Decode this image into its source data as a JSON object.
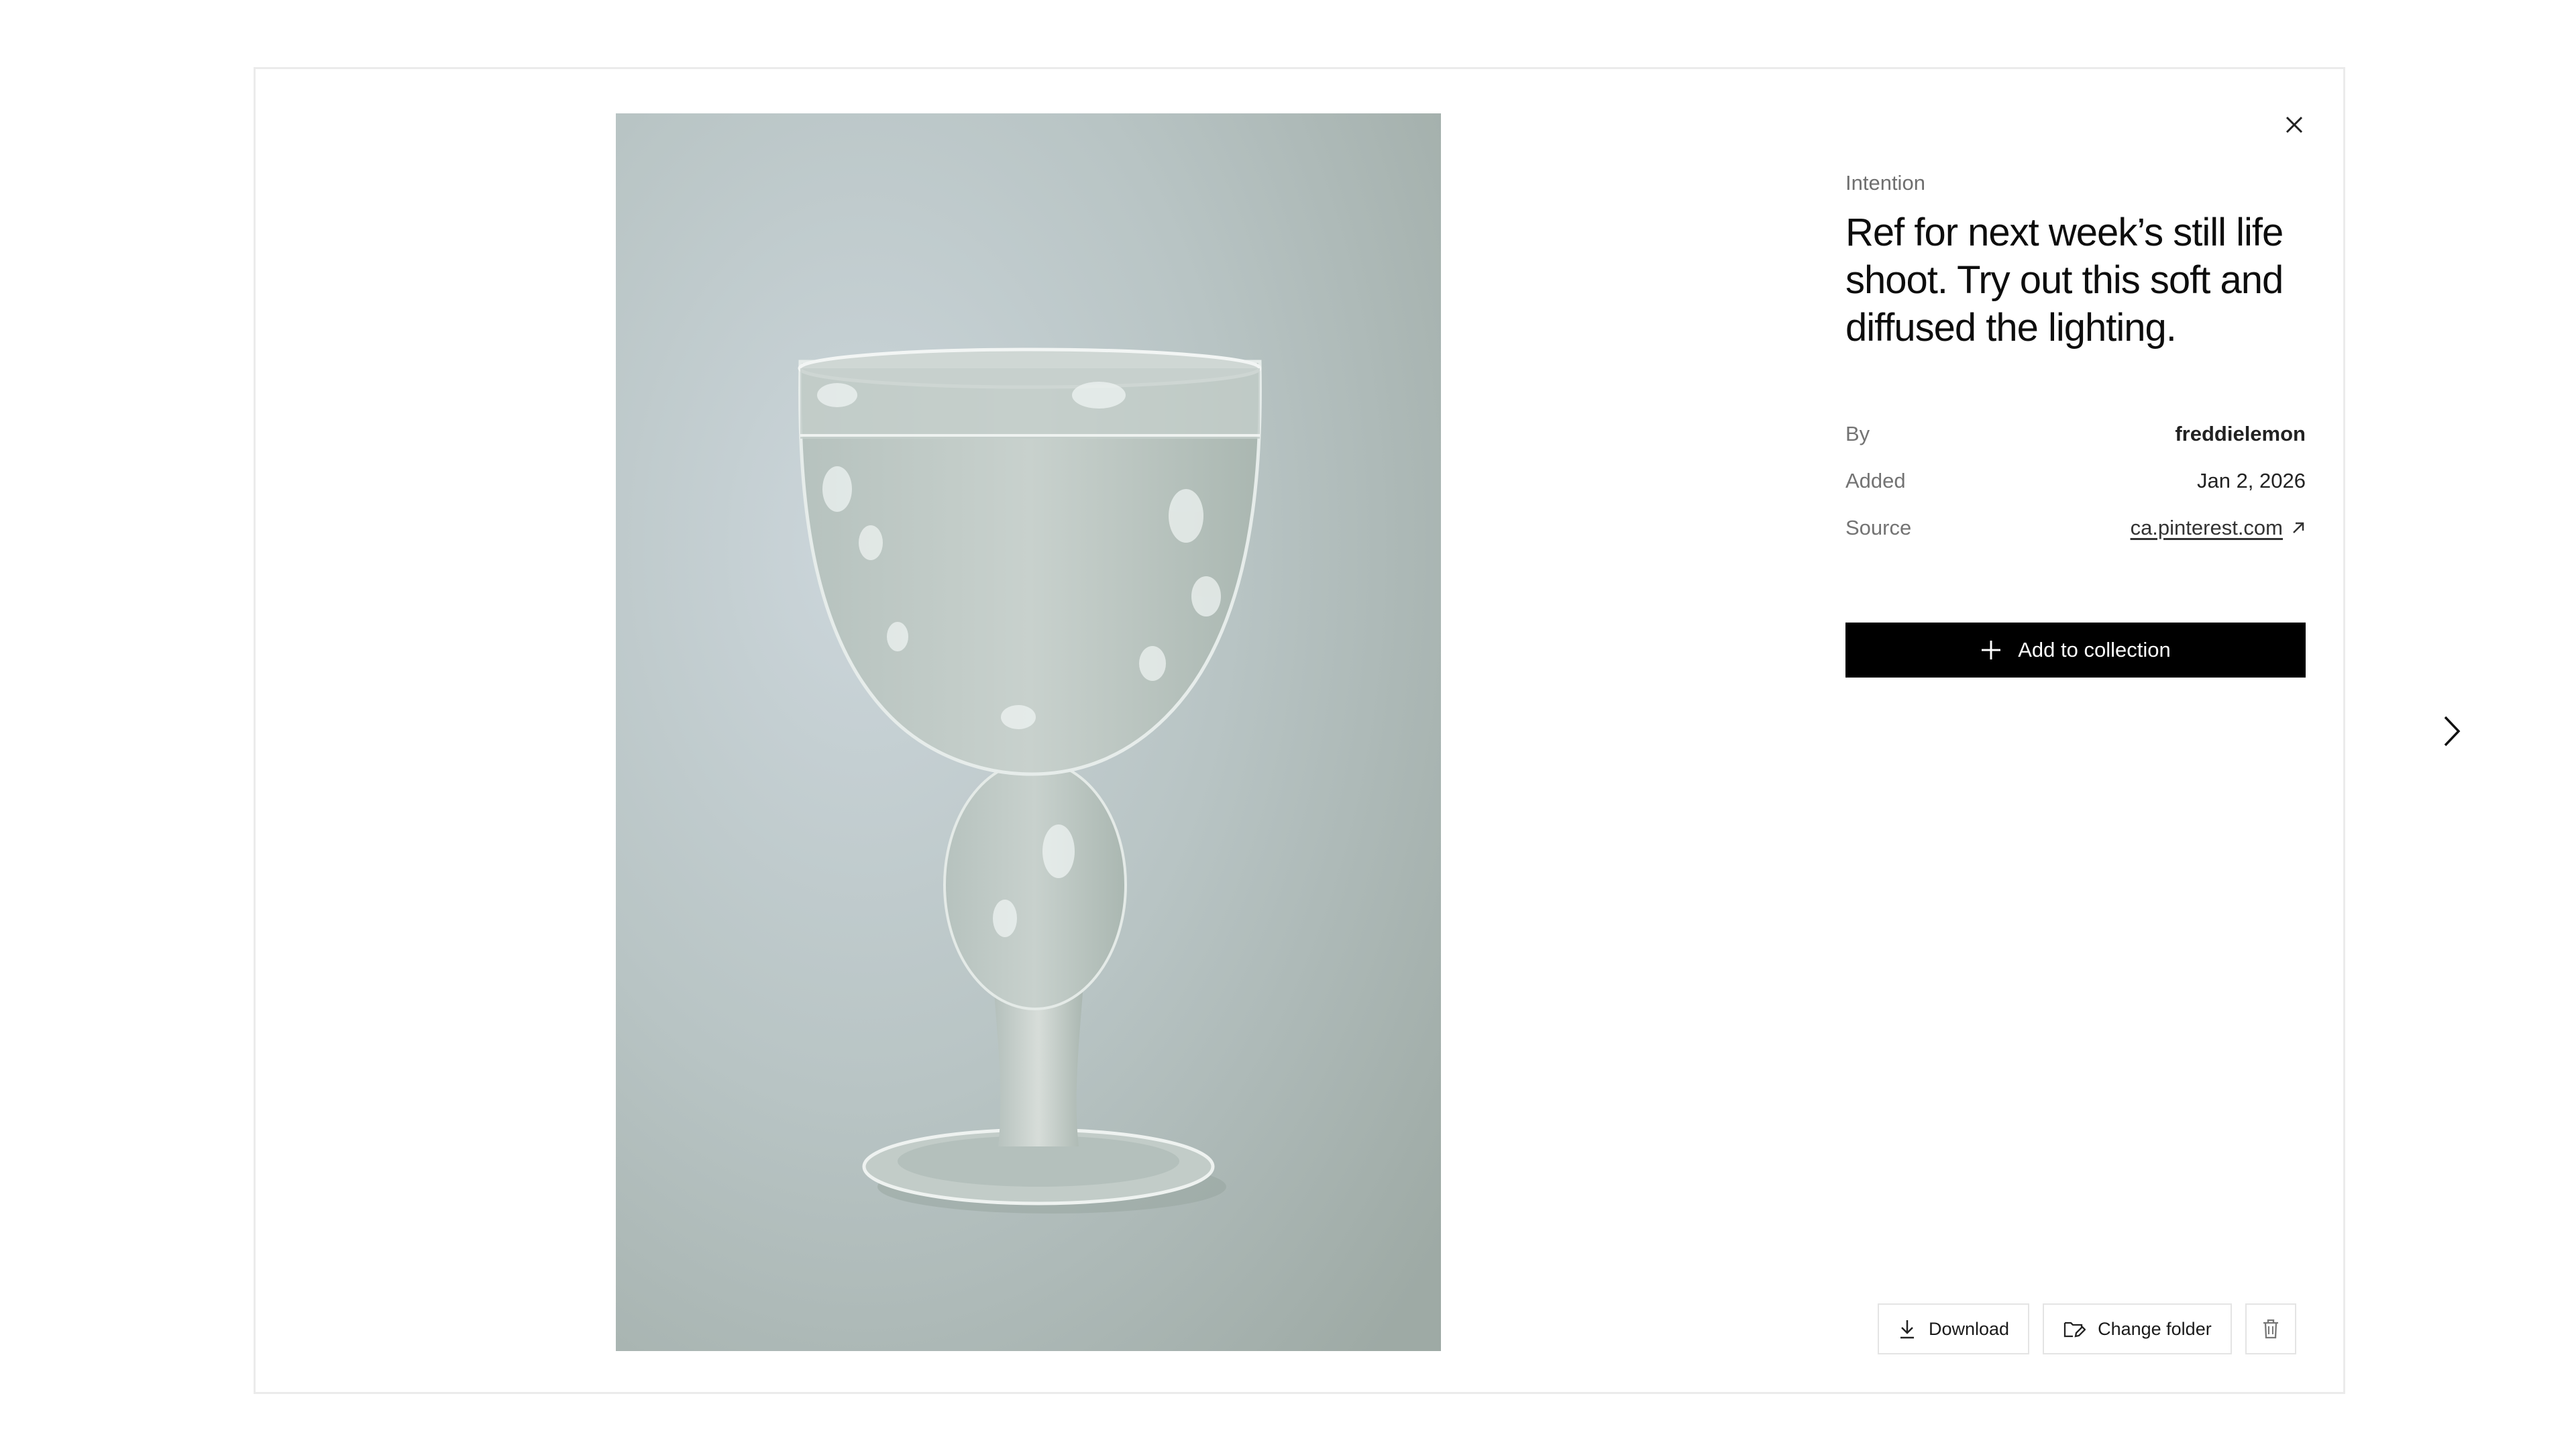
{
  "detail": {
    "eyebrow": "Intention",
    "title": "Ref for next week’s still life shoot. Try out this soft and diffused the lighting.",
    "meta": {
      "by_label": "By",
      "by_value": "freddielemon",
      "added_label": "Added",
      "added_value": "Jan 2, 2026",
      "source_label": "Source",
      "source_value": "ca.pinterest.com"
    },
    "add_button_label": "Add to collection"
  },
  "actions": {
    "download_label": "Download",
    "change_folder_label": "Change folder"
  },
  "icons": {
    "close": "close-icon",
    "next": "chevron-right-icon",
    "external": "arrow-up-right-icon",
    "plus": "plus-icon",
    "download": "download-icon",
    "folder": "folder-edit-icon",
    "trash": "trash-icon"
  },
  "colors": {
    "primary_button": "#000000",
    "photo_background": "#b9c6c7"
  }
}
